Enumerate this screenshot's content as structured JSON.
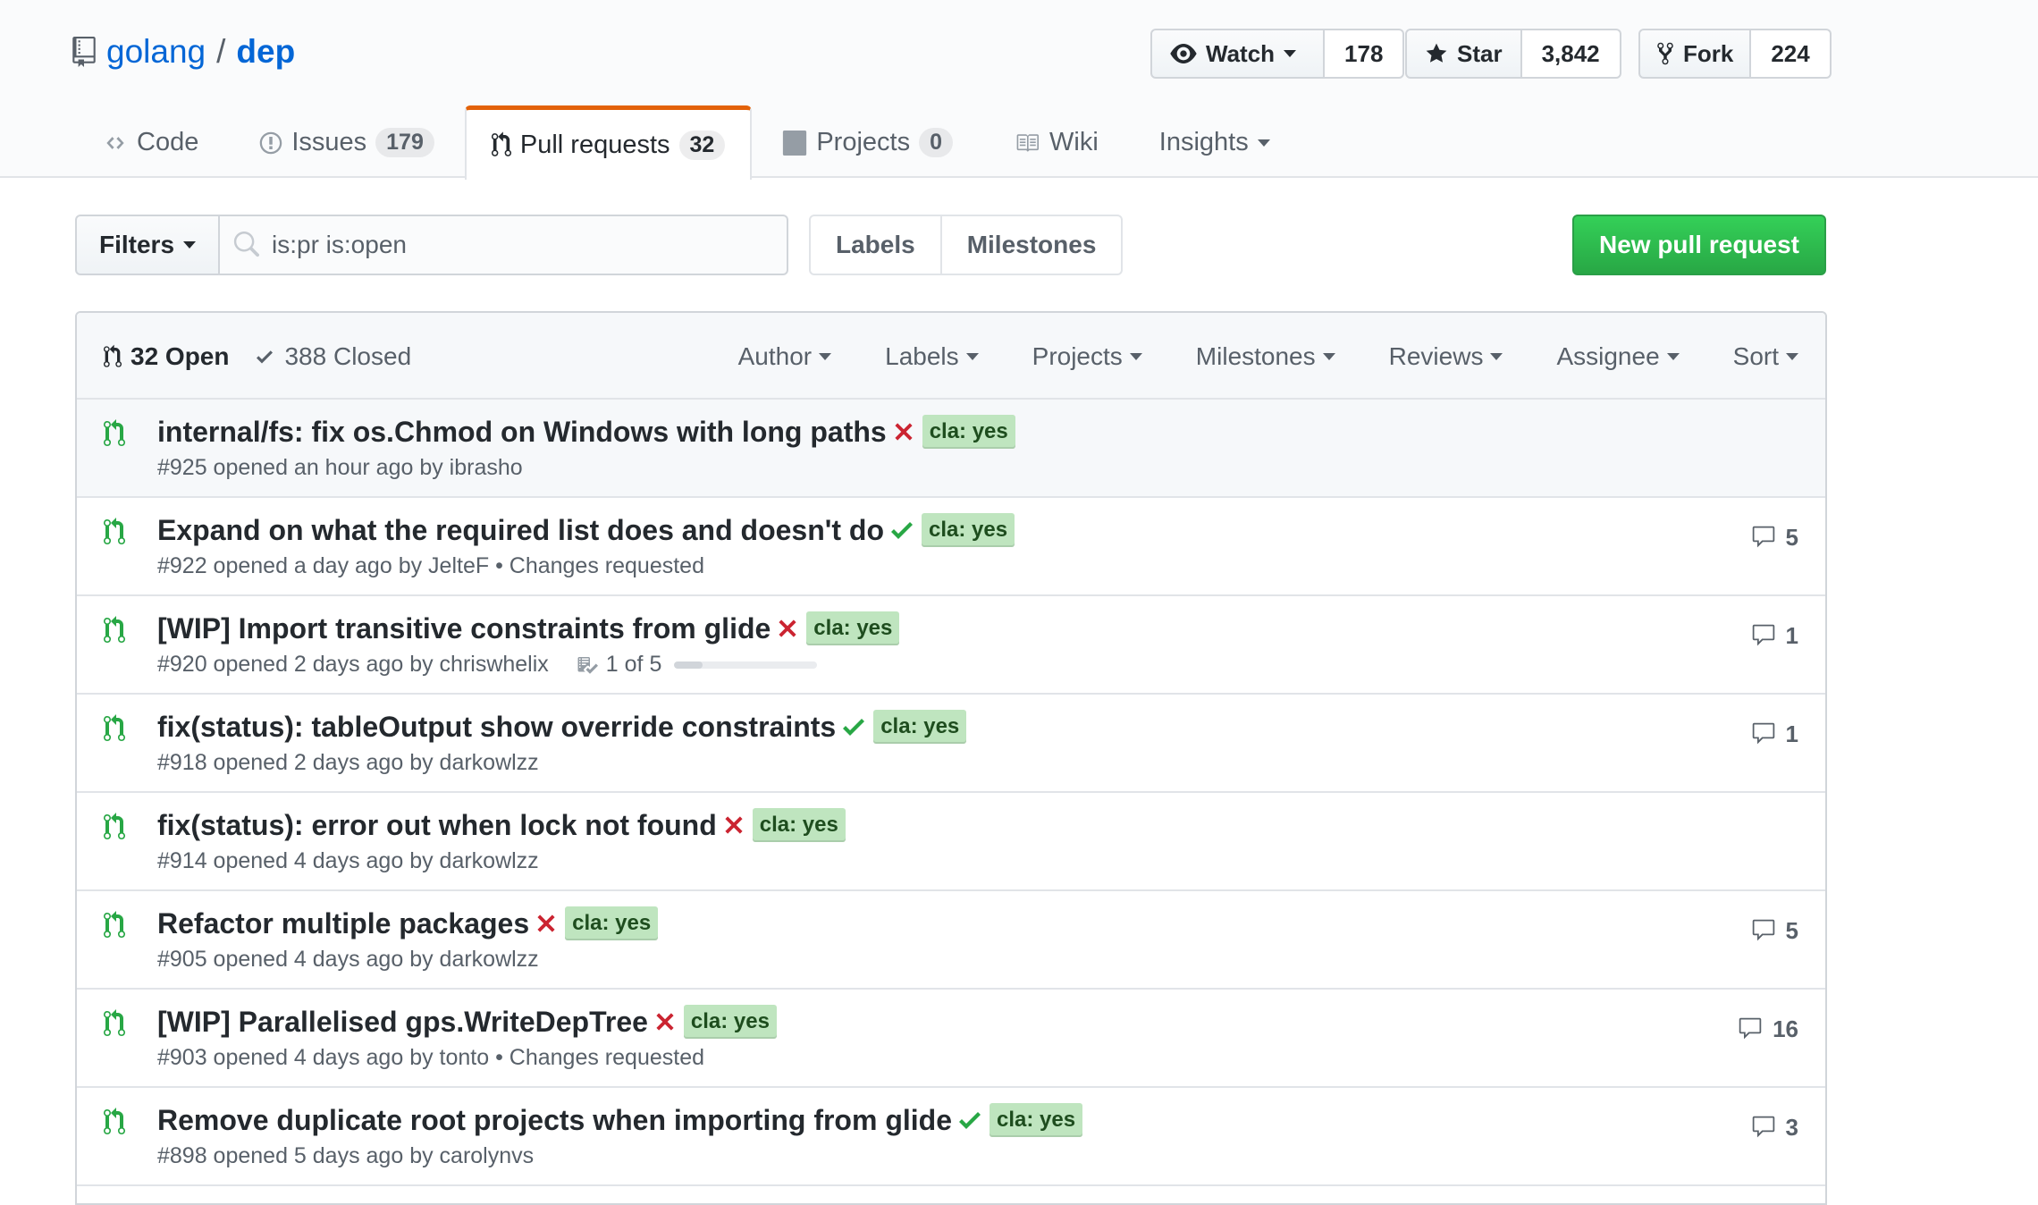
{
  "repo": {
    "owner": "golang",
    "separator": "/",
    "name": "dep"
  },
  "actions": {
    "watch": {
      "label": "Watch",
      "count": "178"
    },
    "star": {
      "label": "Star",
      "count": "3,842"
    },
    "fork": {
      "label": "Fork",
      "count": "224"
    }
  },
  "tabs": [
    {
      "label": "Code",
      "icon": "code-icon"
    },
    {
      "label": "Issues",
      "count": "179",
      "icon": "issue-opened-icon"
    },
    {
      "label": "Pull requests",
      "count": "32",
      "icon": "git-pull-request-icon",
      "selected": true
    },
    {
      "label": "Projects",
      "count": "0",
      "icon": "project-icon"
    },
    {
      "label": "Wiki",
      "icon": "book-icon"
    },
    {
      "label": "Insights",
      "icon": "caret-down-icon"
    }
  ],
  "subnav": {
    "filters_label": "Filters",
    "search_value": "is:pr is:open",
    "labels_label": "Labels",
    "milestones_label": "Milestones",
    "new_pr_label": "New pull request"
  },
  "list_header": {
    "open_label": "32 Open",
    "closed_label": "388 Closed",
    "filters": [
      "Author",
      "Labels",
      "Projects",
      "Milestones",
      "Reviews",
      "Assignee",
      "Sort"
    ]
  },
  "pull_requests": [
    {
      "title": "internal/fs: fix os.Chmod on Windows with long paths",
      "status": "failure",
      "label": "cla: yes",
      "meta": "#925 opened an hour ago by ibrasho",
      "comments": ""
    },
    {
      "title": "Expand on what the required list does and doesn't do",
      "status": "success",
      "label": "cla: yes",
      "meta": "#922 opened a day ago by JelteF • Changes requested",
      "comments": "5"
    },
    {
      "title": "[WIP] Import transitive constraints from glide",
      "status": "failure",
      "label": "cla: yes",
      "meta": "#920 opened 2 days ago by chriswhelix",
      "tasks": "1 of 5",
      "tasks_fraction": 0.2,
      "comments": "1"
    },
    {
      "title": "fix(status): tableOutput show override constraints",
      "status": "success",
      "label": "cla: yes",
      "meta": "#918 opened 2 days ago by darkowlzz",
      "comments": "1"
    },
    {
      "title": "fix(status): error out when lock not found",
      "status": "failure",
      "label": "cla: yes",
      "meta": "#914 opened 4 days ago by darkowlzz",
      "comments": ""
    },
    {
      "title": "Refactor multiple packages",
      "status": "failure",
      "label": "cla: yes",
      "meta": "#905 opened 4 days ago by darkowlzz",
      "comments": "5"
    },
    {
      "title": "[WIP] Parallelised gps.WriteDepTree",
      "status": "failure",
      "label": "cla: yes",
      "meta": "#903 opened 4 days ago by tonto • Changes requested",
      "comments": "16"
    },
    {
      "title": "Remove duplicate root projects when importing from glide",
      "status": "success",
      "label": "cla: yes",
      "meta": "#898 opened 5 days ago by carolynvs",
      "comments": "3"
    }
  ],
  "colors": {
    "link": "#0366d6",
    "open_green": "#28a745",
    "failure_red": "#cb2431",
    "label_bg": "#bfe5bf",
    "tab_accent": "#e36209"
  }
}
